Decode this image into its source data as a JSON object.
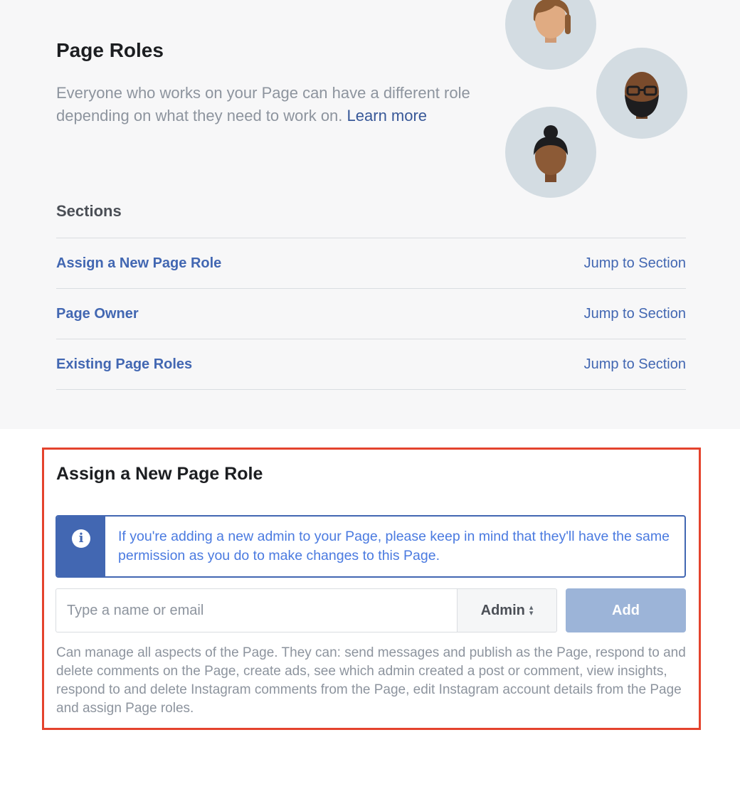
{
  "header": {
    "title": "Page Roles",
    "description": "Everyone who works on your Page can have a different role depending on what they need to work on.",
    "learn_more": "Learn more"
  },
  "sections": {
    "title": "Sections",
    "items": [
      {
        "label": "Assign a New Page Role",
        "action": "Jump to Section"
      },
      {
        "label": "Page Owner",
        "action": "Jump to Section"
      },
      {
        "label": "Existing Page Roles",
        "action": "Jump to Section"
      }
    ]
  },
  "assign": {
    "title": "Assign a New Page Role",
    "notice": "If you're adding a new admin to your Page, please keep in mind that they'll have the same permission as you do to make changes to this Page.",
    "input_placeholder": "Type a name or email",
    "input_value": "",
    "role_selected": "Admin",
    "add_label": "Add",
    "role_description": "Can manage all aspects of the Page. They can: send messages and publish as the Page, respond to and delete comments on the Page, create ads, see which admin created a post or comment, view insights, respond to and delete Instagram comments from the Page, edit Instagram account details from the Page and assign Page roles."
  },
  "colors": {
    "accent": "#4267b2",
    "highlight_border": "#e4432d",
    "add_button": "#9cb4d8",
    "avatar_bg": "#d3dce2"
  },
  "icons": [
    "person-avatar-1",
    "person-avatar-2",
    "person-avatar-3",
    "info-icon",
    "sort-arrows-icon"
  ]
}
